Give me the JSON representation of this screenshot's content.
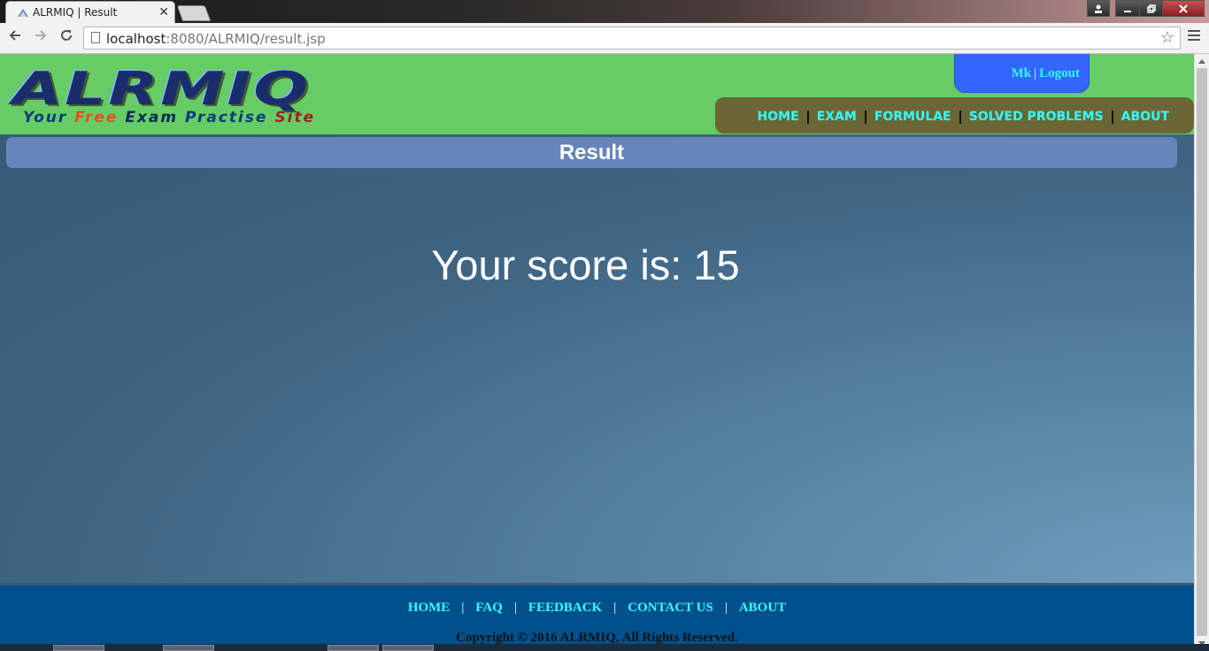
{
  "browser": {
    "tab_title": "ALRMIQ | Result",
    "tab_close": "✕",
    "url_host": "localhost",
    "url_path": ":8080/ALRMIQ/result.jsp",
    "back_icon": "arrow-left",
    "forward_icon": "arrow-right",
    "reload_icon": "reload",
    "star_icon": "☆",
    "window_controls": [
      "user",
      "minimize",
      "restore",
      "close"
    ]
  },
  "header": {
    "logo_text": "ALRMIQ",
    "tagline": [
      "Your",
      "Free",
      "Exam",
      "Practise",
      "Site"
    ],
    "user": {
      "name": "Mk",
      "separator": "|",
      "logout": "Logout"
    },
    "nav": [
      "HOME",
      "EXAM",
      "FORMULAE",
      "SOLVED PROBLEMS",
      "ABOUT"
    ]
  },
  "main": {
    "title": "Result",
    "score_text": "Your score is: 15"
  },
  "footer": {
    "links": [
      "HOME",
      "FAQ",
      "FEEDBACK",
      "CONTACT US",
      "ABOUT"
    ],
    "separator": "|",
    "copyright": "Copyright © 2016 ALRMIQ, All Rights Reserved."
  },
  "colors": {
    "header_bg": "#66cc66",
    "nav_bg": "#6b6635",
    "nav_link": "#33ffff",
    "user_box": "#3366ff",
    "result_bar": "#6785b8",
    "footer_bg": "#00508e"
  }
}
